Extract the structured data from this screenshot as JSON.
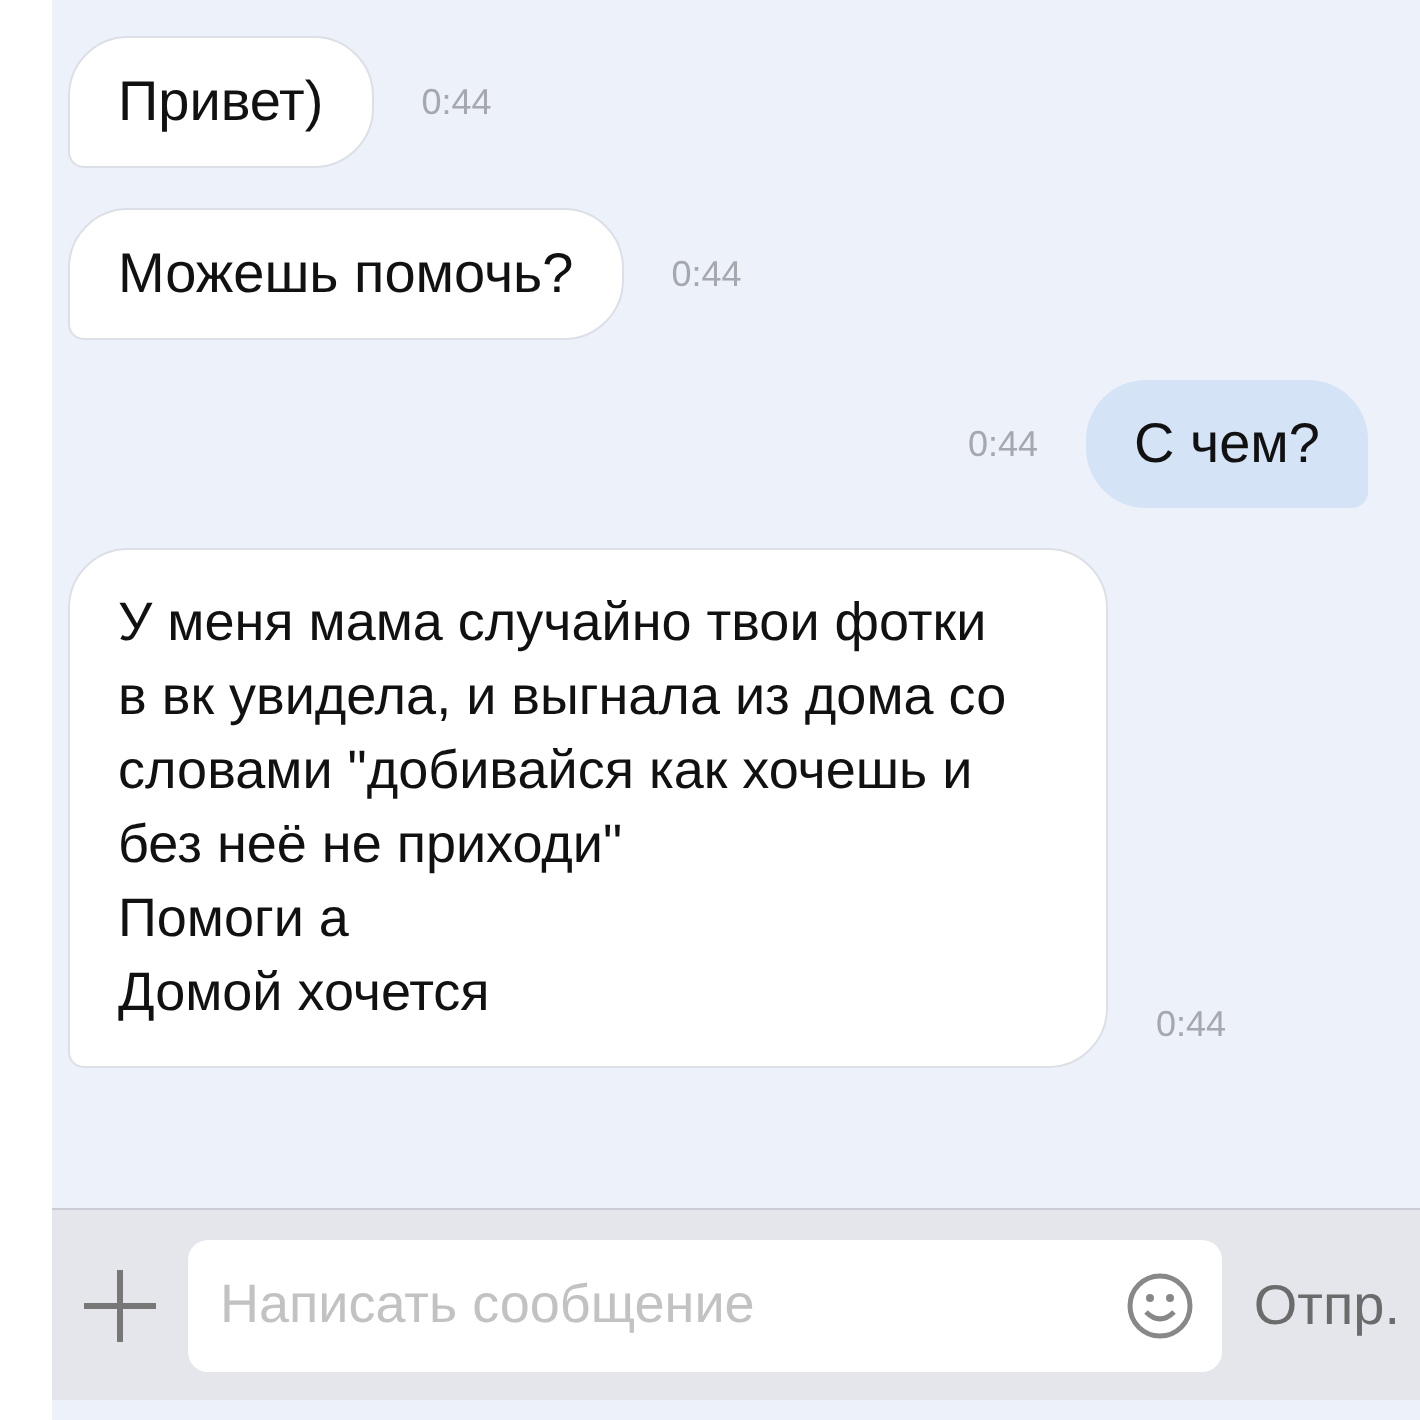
{
  "messages": [
    {
      "outgoing": false,
      "text": "Привет)",
      "time": "0:44"
    },
    {
      "outgoing": false,
      "text": "Можешь помочь?",
      "time": "0:44"
    },
    {
      "outgoing": true,
      "text": "С чем?",
      "time": "0:44"
    },
    {
      "outgoing": false,
      "text": "У меня мама случайно твои фотки в вк увидела, и выгнала из дома со словами \"добивайся как хочешь и без неё не приходи\"\nПомоги а\nДомой хочется",
      "time": "0:44"
    }
  ],
  "composer": {
    "placeholder": "Написать сообщение",
    "send_label": "Отпр."
  }
}
